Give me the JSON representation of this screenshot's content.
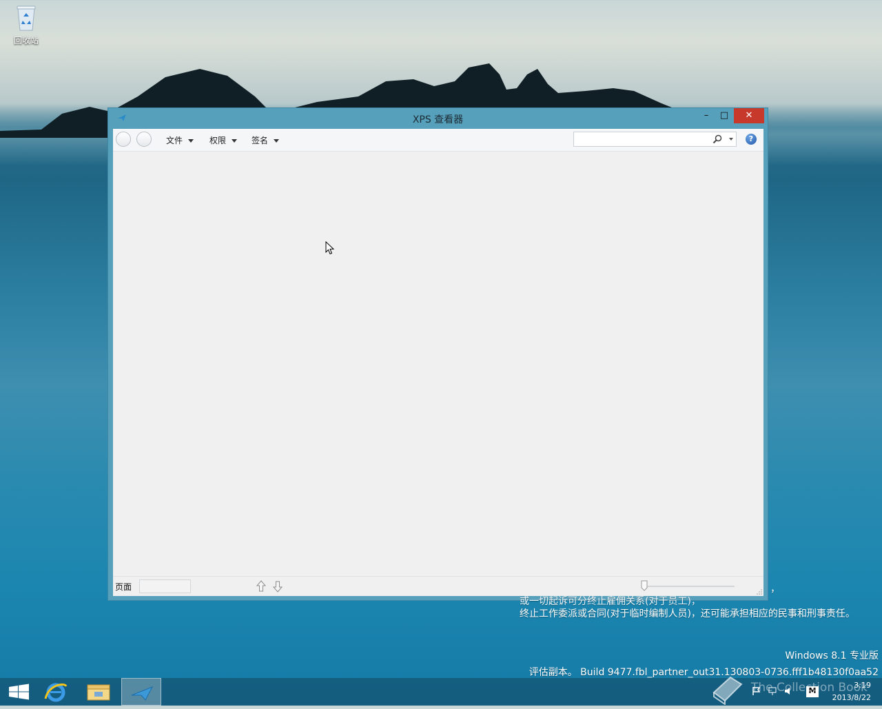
{
  "desktop": {
    "recycle_bin_label": "回收站"
  },
  "window": {
    "title": "XPS 查看器",
    "buttons": {
      "minimize": "–",
      "maximize": "□",
      "close": "✕"
    },
    "toolbar": {
      "menus": [
        "文件",
        "权限",
        "签名"
      ],
      "search_placeholder": "",
      "help_label": "?"
    },
    "statusbar": {
      "page_label": "页面",
      "page_value": ""
    }
  },
  "watermark": {
    "comma": "，",
    "partial_line": "或一切起诉可分终止雇佣关系(对于员工)，",
    "line1": "终止工作委派或合同(对于临时编制人员)，还可能承担相应的民事和刑事责任。",
    "edition": "Windows 8.1 专业版",
    "build": "评估副本。 Build 9477.fbl_partner_out31.130803-0736.fff1b48130f0aa52"
  },
  "taskbar": {
    "brand_overlay": "The Collection Book",
    "time": "3:19",
    "date": "2013/8/22",
    "ime": "M"
  }
}
